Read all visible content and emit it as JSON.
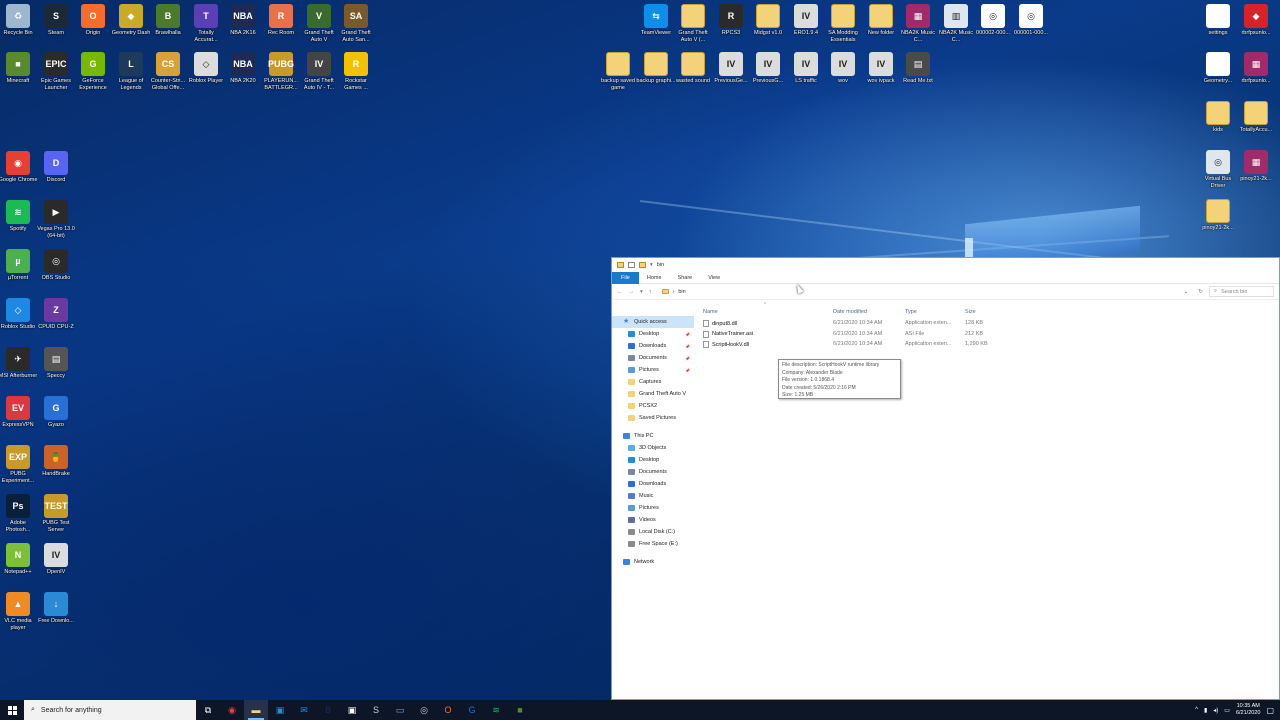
{
  "desktop": {
    "icons": [
      {
        "label": "Recycle Bin",
        "color": "#9fb6cf",
        "glyph": "♻"
      },
      {
        "label": "Steam",
        "color": "#1b2838",
        "glyph": "S"
      },
      {
        "label": "Origin",
        "color": "#f56c2d",
        "glyph": "O"
      },
      {
        "label": "Geometry Dash",
        "color": "#c8a92a",
        "glyph": "◆"
      },
      {
        "label": "Brawlhalla",
        "color": "#4a7a2a",
        "glyph": "B"
      },
      {
        "label": "Totally Accurat...",
        "color": "#5b3fb5",
        "glyph": "T"
      },
      {
        "label": "NBA 2K16",
        "color": "#1d2a56",
        "glyph": "NBA"
      },
      {
        "label": "Rec Room",
        "color": "#e8704a",
        "glyph": "R"
      },
      {
        "label": "Grand Theft Auto V",
        "color": "#3a6b2e",
        "glyph": "V"
      },
      {
        "label": "Grand Theft Auto San...",
        "color": "#7a5a2a",
        "glyph": "SA"
      },
      {
        "label": "Minecraft",
        "color": "#5a8a2e",
        "glyph": "■"
      },
      {
        "label": "Epic Games Launcher",
        "color": "#2a2a2a",
        "glyph": "EPIC"
      },
      {
        "label": "GeForce Experience",
        "color": "#76b900",
        "glyph": "G"
      },
      {
        "label": "League of Legends",
        "color": "#1e3a5a",
        "glyph": "L"
      },
      {
        "label": "Counter-Stri... Global Offe...",
        "color": "#d8a23a",
        "glyph": "CS"
      },
      {
        "label": "Roblox Player",
        "color": "#dcdcdc",
        "glyph": "◇"
      },
      {
        "label": "NBA 2K20",
        "color": "#1d2a56",
        "glyph": "NBA"
      },
      {
        "label": "PLAYERUN... BATTLEGR...",
        "color": "#c89a2a",
        "glyph": "PUBG"
      },
      {
        "label": "Grand Theft Auto IV - T...",
        "color": "#444444",
        "glyph": "IV"
      },
      {
        "label": "Rockstar Games ...",
        "color": "#f2c200",
        "glyph": "R"
      },
      {
        "label": "Google Chrome",
        "color": "#e44134",
        "glyph": "◉"
      },
      {
        "label": "Discord",
        "color": "#5865f2",
        "glyph": "D"
      },
      {
        "label": "Spotify",
        "color": "#1db954",
        "glyph": "≋"
      },
      {
        "label": "Vegas Pro 13.0 (64-bit)",
        "color": "#2a2a2a",
        "glyph": "▶"
      },
      {
        "label": "µTorrent",
        "color": "#4caf50",
        "glyph": "µ"
      },
      {
        "label": "OBS Studio",
        "color": "#2a2a2a",
        "glyph": "◎"
      },
      {
        "label": "Roblox Studio",
        "color": "#1e88e5",
        "glyph": "◇"
      },
      {
        "label": "CPUID CPU-Z",
        "color": "#6a3aa0",
        "glyph": "Z"
      },
      {
        "label": "MSI Afterburner",
        "color": "#2a2a2a",
        "glyph": "✈"
      },
      {
        "label": "Speccy",
        "color": "#555555",
        "glyph": "▤"
      },
      {
        "label": "ExpressVPN",
        "color": "#da3940",
        "glyph": "EV"
      },
      {
        "label": "Gyazo",
        "color": "#2a6fd6",
        "glyph": "G"
      },
      {
        "label": "PUBG Experiment...",
        "color": "#c89a2a",
        "glyph": "EXP"
      },
      {
        "label": "HandBrake",
        "color": "#c9632a",
        "glyph": "🍍"
      },
      {
        "label": "Adobe Photosh...",
        "color": "#0a1f3a",
        "glyph": "Ps"
      },
      {
        "label": "PUBG Test Server",
        "color": "#c89a2a",
        "glyph": "TEST"
      },
      {
        "label": "Notepad++",
        "color": "#7cbf3a",
        "glyph": "N"
      },
      {
        "label": "OpenIV",
        "color": "#dcdcdc",
        "glyph": "IV"
      },
      {
        "label": "VLC media player",
        "color": "#f08a24",
        "glyph": "▲"
      },
      {
        "label": "Free Downlo...",
        "color": "#2a8ad6",
        "glyph": "↓"
      },
      {
        "label": "TeamViewer",
        "color": "#0e8ee9",
        "glyph": "⇆"
      },
      {
        "label": "Grand Theft Auto V (...",
        "color": "#f3d27a",
        "glyph": ""
      },
      {
        "label": "RPCS3",
        "color": "#2a2a2a",
        "glyph": "R"
      },
      {
        "label": "Midgst v1.0",
        "color": "#f3d27a",
        "glyph": ""
      },
      {
        "label": "ERO1.9.4",
        "color": "#dcdcdc",
        "glyph": "IV"
      },
      {
        "label": "SA Modding Essentials",
        "color": "#f3d27a",
        "glyph": ""
      },
      {
        "label": "New folder",
        "color": "#f3d27a",
        "glyph": ""
      },
      {
        "label": "NBA2K Music C...",
        "color": "#a02a6a",
        "glyph": "▦"
      },
      {
        "label": "NBA2K Music C...",
        "color": "#dfe6f0",
        "glyph": "▥"
      },
      {
        "label": "000002-000...",
        "color": "#ffffff",
        "glyph": "◎"
      },
      {
        "label": "000001-000...",
        "color": "#ffffff",
        "glyph": "◎"
      },
      {
        "label": "backup saved game",
        "color": "#f3d27a",
        "glyph": ""
      },
      {
        "label": "backup graphi...",
        "color": "#f3d27a",
        "glyph": ""
      },
      {
        "label": "wasted sound",
        "color": "#f3d27a",
        "glyph": ""
      },
      {
        "label": "PreviousGe...",
        "color": "#dcdcdc",
        "glyph": "IV"
      },
      {
        "label": "PreviousG...",
        "color": "#dcdcdc",
        "glyph": "IV"
      },
      {
        "label": "LS traffic",
        "color": "#dcdcdc",
        "glyph": "IV"
      },
      {
        "label": "wov",
        "color": "#dcdcdc",
        "glyph": "IV"
      },
      {
        "label": "wov ivpack",
        "color": "#dcdcdc",
        "glyph": "IV"
      },
      {
        "label": "Read Me.txt",
        "color": "#4a4a4a",
        "glyph": "▤"
      },
      {
        "label": "settings",
        "color": "#ffffff",
        "glyph": ""
      },
      {
        "label": "rbrfpsunlo...",
        "color": "#d6232a",
        "glyph": "◆"
      },
      {
        "label": "Geometry...",
        "color": "#ffffff",
        "glyph": ""
      },
      {
        "label": "rbrfpsunlo...",
        "color": "#a02a6a",
        "glyph": "▦"
      },
      {
        "label": "kids",
        "color": "#f3d27a",
        "glyph": ""
      },
      {
        "label": "TotallyAccu...",
        "color": "#f3d27a",
        "glyph": ""
      },
      {
        "label": "Virtual Bus Driver",
        "color": "#dfe6f0",
        "glyph": "◎"
      },
      {
        "label": "pinoy21-2k...",
        "color": "#a02a6a",
        "glyph": "▦"
      },
      {
        "label": "pinoy21-2k...",
        "color": "#f3d27a",
        "glyph": ""
      }
    ]
  },
  "explorer": {
    "title": "bin",
    "tabs": [
      "File",
      "Home",
      "Share",
      "View"
    ],
    "address": "bin",
    "search_placeholder": "Search bin",
    "columns": {
      "name": "Name",
      "date": "Date modified",
      "type": "Type",
      "size": "Size"
    },
    "nav": [
      {
        "label": "Quick access",
        "kind": "star",
        "selected": true,
        "pin": false
      },
      {
        "label": "Desktop",
        "kind": "desktop",
        "pin": true
      },
      {
        "label": "Downloads",
        "kind": "downloads",
        "pin": true
      },
      {
        "label": "Documents",
        "kind": "documents",
        "pin": true
      },
      {
        "label": "Pictures",
        "kind": "pictures",
        "pin": true
      },
      {
        "label": "Captures",
        "kind": "folder",
        "pin": false
      },
      {
        "label": "Grand Theft Auto V",
        "kind": "folder",
        "pin": false
      },
      {
        "label": "PCSX2",
        "kind": "folder",
        "pin": false
      },
      {
        "label": "Saved Pictures",
        "kind": "folder",
        "pin": false
      },
      {
        "label": "This PC",
        "kind": "pc",
        "pin": false
      },
      {
        "label": "3D Objects",
        "kind": "obj3d",
        "pin": false
      },
      {
        "label": "Desktop",
        "kind": "desktop",
        "pin": false
      },
      {
        "label": "Documents",
        "kind": "documents",
        "pin": false
      },
      {
        "label": "Downloads",
        "kind": "downloads",
        "pin": false
      },
      {
        "label": "Music",
        "kind": "music",
        "pin": false
      },
      {
        "label": "Pictures",
        "kind": "pictures",
        "pin": false
      },
      {
        "label": "Videos",
        "kind": "videos",
        "pin": false
      },
      {
        "label": "Local Disk (C:)",
        "kind": "disk",
        "pin": false
      },
      {
        "label": "Free Space (E:)",
        "kind": "disk",
        "pin": false
      },
      {
        "label": "Network",
        "kind": "network",
        "pin": false
      }
    ],
    "files": [
      {
        "name": "dinput8.dll",
        "date": "6/21/2020 10:34 AM",
        "type": "Application exten...",
        "size": "128 KB"
      },
      {
        "name": "NativeTrainer.asi",
        "date": "6/21/2020 10:34 AM",
        "type": "ASI File",
        "size": "212 KB"
      },
      {
        "name": "ScriptHookV.dll",
        "date": "6/21/2020 10:34 AM",
        "type": "Application exten...",
        "size": "1,290 KB"
      }
    ],
    "tooltip": [
      "File description: ScriptHookV runtime library",
      "Company: Alexander Blade",
      "File version: 1.0.1868.4",
      "Date created: 5/26/2020 2:16 PM",
      "Size: 1.25 MB"
    ]
  },
  "taskbar": {
    "search_placeholder": "Search for anything",
    "apps": [
      {
        "name": "task-view",
        "glyph": "⧉",
        "color": "#ffffff"
      },
      {
        "name": "chrome",
        "glyph": "◉",
        "color": "#e44134"
      },
      {
        "name": "file-explorer",
        "glyph": "▬",
        "color": "#f3d27a",
        "active": true
      },
      {
        "name": "store",
        "glyph": "▣",
        "color": "#2a8ad6"
      },
      {
        "name": "mail",
        "glyph": "✉",
        "color": "#2a8ad6"
      },
      {
        "name": "nba2k",
        "glyph": "B",
        "color": "#1d2a56"
      },
      {
        "name": "obs-like",
        "glyph": "▣",
        "color": "#ffffff"
      },
      {
        "name": "steam",
        "glyph": "S",
        "color": "#c7d5e0"
      },
      {
        "name": "app-blue",
        "glyph": "▭",
        "color": "#7aa6d6"
      },
      {
        "name": "obs",
        "glyph": "◎",
        "color": "#cccccc"
      },
      {
        "name": "origin",
        "glyph": "O",
        "color": "#f56c2d"
      },
      {
        "name": "gyazo",
        "glyph": "G",
        "color": "#2a6fd6"
      },
      {
        "name": "spotify",
        "glyph": "≋",
        "color": "#1db954"
      },
      {
        "name": "minecraft",
        "glyph": "■",
        "color": "#5a8a2e"
      }
    ],
    "time": "10:35 AM",
    "date": "6/21/2020"
  }
}
